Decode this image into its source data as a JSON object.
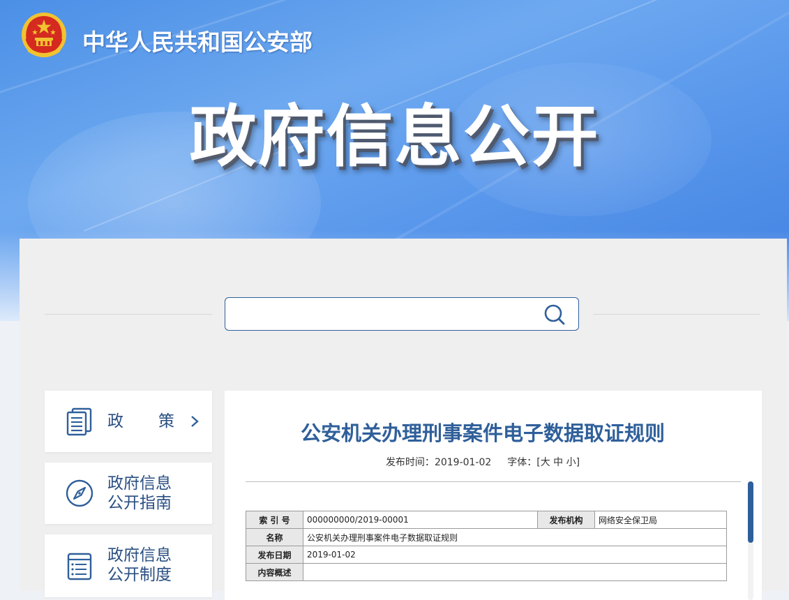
{
  "header": {
    "ministry": "中华人民共和国公安部",
    "hero_title": "政府信息公开"
  },
  "search": {
    "value": "",
    "placeholder": ""
  },
  "sidebar": {
    "items": [
      {
        "label": "政策",
        "icon": "document-stack-icon"
      },
      {
        "label": "政府信息公开指南",
        "icon": "compass-icon"
      },
      {
        "label": "政府信息公开制度",
        "icon": "list-document-icon"
      }
    ]
  },
  "article": {
    "title": "公安机关办理刑事案件电子数据取证规则",
    "publish_label": "发布时间：",
    "publish_date": "2019-01-02",
    "font_label": "字体：",
    "font_open": "[",
    "font_large": "大",
    "font_medium": "中",
    "font_small": "小",
    "font_close": "]"
  },
  "info_table": {
    "index_key": "索 引 号",
    "index_value": "000000000/2019-00001",
    "org_key": "发布机构",
    "org_value": "网络安全保卫局",
    "name_key": "名称",
    "name_value": "公安机关办理刑事案件电子数据取证规则",
    "date_key": "发布日期",
    "date_value": "2019-01-02",
    "summary_key": "内容概述",
    "summary_value": ""
  },
  "colors": {
    "brand_blue": "#2f5f9a",
    "banner_blue": "#5a98ec",
    "emblem_red": "#d42a20",
    "emblem_gold": "#f2c230"
  }
}
